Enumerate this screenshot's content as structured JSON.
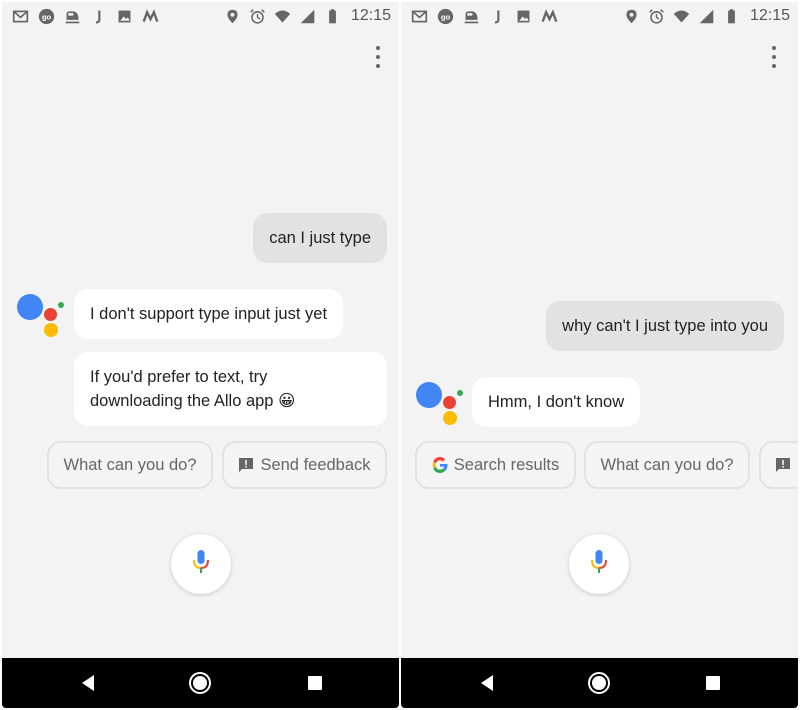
{
  "colors": {
    "background": "#f3f3f3",
    "user_bubble": "#e2e2e2",
    "assistant_bubble": "#ffffff",
    "google_blue": "#4285F4",
    "google_red": "#EA4335",
    "google_yellow": "#FBBC05",
    "google_green": "#34A853",
    "navbar": "#000000"
  },
  "status_bar": {
    "time": "12:15",
    "notification_icons": [
      "gmail-icon",
      "go-icon",
      "train-icon",
      "j-icon",
      "image-icon",
      "m-icon"
    ],
    "system_icons": [
      "location-icon",
      "alarm-icon",
      "wifi-icon",
      "cell-signal-icon",
      "battery-icon"
    ]
  },
  "screens": [
    {
      "messages": [
        {
          "role": "user",
          "text": "can I just type"
        },
        {
          "role": "assistant",
          "text": "I don't support type input just yet"
        },
        {
          "role": "assistant",
          "line1": "If you'd prefer to text, try",
          "line2": "downloading the Allo app",
          "emoji": "😀"
        }
      ],
      "chips": [
        {
          "label": "What can you do?",
          "icon": null
        },
        {
          "label": "Send feedback",
          "icon": "feedback-icon"
        }
      ]
    },
    {
      "messages": [
        {
          "role": "user",
          "text": "why can't I just type into you"
        },
        {
          "role": "assistant",
          "text": "Hmm, I don't know"
        }
      ],
      "chips": [
        {
          "label": "Search results",
          "icon": "google-g-icon"
        },
        {
          "label": "What can you do?",
          "icon": null
        },
        {
          "label": "",
          "icon": "feedback-icon"
        }
      ]
    }
  ],
  "navigation": {
    "back": "back-icon",
    "home": "home-icon",
    "recents": "recents-icon"
  }
}
